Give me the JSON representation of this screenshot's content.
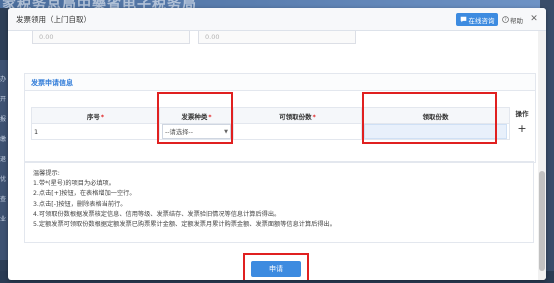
{
  "background": {
    "banner_text": "家税务总局中樂省电子税务局",
    "left_texts": [
      "办",
      "开",
      "报",
      "缴",
      "退",
      "优",
      "查",
      "业"
    ]
  },
  "modal": {
    "title": "发票领用（上门自取）",
    "online_consult_label": "在线咨询",
    "help_label": "帮助",
    "close_icon": "✕"
  },
  "top_fields": {
    "field_1_value": "0.00",
    "field_2_value": "0.00"
  },
  "application": {
    "section_title": "发票申请信息",
    "columns": {
      "seq": "序号",
      "invoice_type": "发票种类",
      "available_qty": "可领取份数",
      "receive_qty": "领取份数",
      "action": "操作"
    },
    "required_mark": "*",
    "row": {
      "seq": "1",
      "invoice_type_value": "--请选择--",
      "available_qty": "",
      "receive_qty": ""
    },
    "add_button_label": "+"
  },
  "tips": {
    "title": "温馨提示:",
    "lines": [
      "1.带*(星号)的项目为必填项。",
      "2.点击[+]按钮，在表格增加一空行。",
      "3.点击[-]按钮，删除表格当前行。",
      "4.可领取份数根据发票核定信息、信用等级、发票结存、发票验旧情况等信息计算后得出。",
      "5.定额发票可领取份数根据定额发票已购票累计金额、定额发票月累计购票金额、发票面额等信息计算后得出。"
    ]
  },
  "submit_label": "申请",
  "colors": {
    "accent": "#3d8be0",
    "title_blue": "#2f7bd8",
    "highlight_red": "#e02020",
    "required_red": "#e02020"
  }
}
